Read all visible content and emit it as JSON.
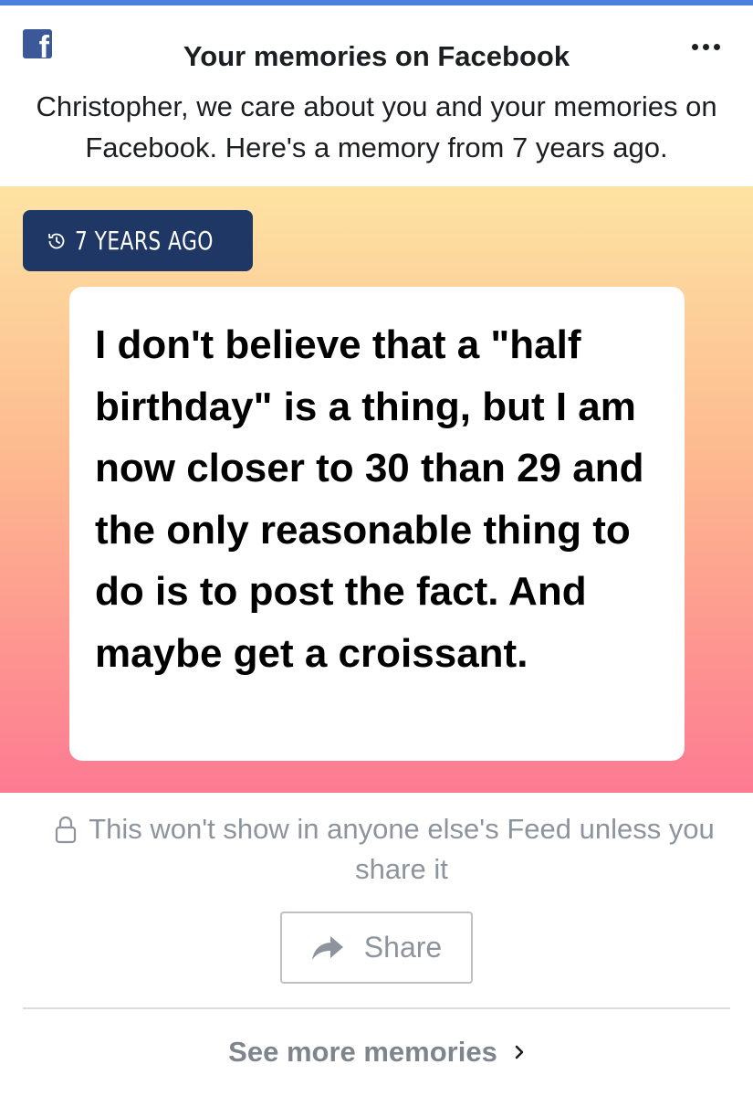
{
  "header": {
    "logo_icon": "facebook-logo-icon",
    "logo_glyph": "f",
    "title": "Your memories on Facebook",
    "subtitle": "Christopher, we care about you and your memories on Facebook. Here's a memory from 7 years ago.",
    "more_icon": "more-options-icon"
  },
  "memory": {
    "badge_icon": "history-clock-icon",
    "badge_label": "7 YEARS AGO",
    "post_text": "I don't believe that a \"half birthday\" is a thing, but I am now closer to 30 than 29 and the only reasonable thing to do is to post the fact. And maybe get a croissant.",
    "gradient_colors": [
      "#fde3a3",
      "#fdb98f",
      "#fd7a92"
    ]
  },
  "privacy": {
    "icon": "lock-icon",
    "text": "This won't show in anyone else's Feed unless you share it"
  },
  "share_button": {
    "icon": "share-arrow-icon",
    "label": "Share"
  },
  "footer": {
    "see_more_label": "See more memories",
    "chevron_icon": "chevron-right-icon"
  },
  "colors": {
    "accent_bar": "#4a7fe0",
    "facebook_blue": "#3b5998",
    "badge_background": "#1e3764",
    "muted_text": "#8d949e"
  }
}
